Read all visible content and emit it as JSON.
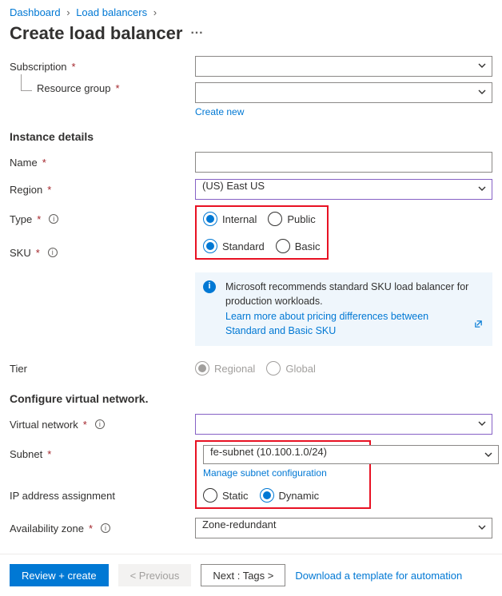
{
  "breadcrumb": {
    "items": [
      "Dashboard",
      "Load balancers"
    ]
  },
  "page_title": "Create load balancer",
  "subscription": {
    "label": "Subscription",
    "value": ""
  },
  "resource_group": {
    "label": "Resource group",
    "value": "",
    "create_new": "Create new"
  },
  "sections": {
    "instance": "Instance details",
    "configure_vnet": "Configure virtual network."
  },
  "name": {
    "label": "Name",
    "value": ""
  },
  "region": {
    "label": "Region",
    "value": "(US) East US"
  },
  "type": {
    "label": "Type",
    "options": {
      "internal": "Internal",
      "public": "Public"
    },
    "selected": "internal"
  },
  "sku": {
    "label": "SKU",
    "options": {
      "standard": "Standard",
      "basic": "Basic"
    },
    "selected": "standard"
  },
  "info_panel": {
    "text": "Microsoft recommends standard SKU load balancer for production workloads.",
    "link": "Learn more about pricing differences between Standard and Basic SKU"
  },
  "tier": {
    "label": "Tier",
    "options": {
      "regional": "Regional",
      "global": "Global"
    }
  },
  "vnet": {
    "label": "Virtual network",
    "value": ""
  },
  "subnet": {
    "label": "Subnet",
    "value": "fe-subnet (10.100.1.0/24)",
    "manage_link": "Manage subnet configuration"
  },
  "ip_assignment": {
    "label": "IP address assignment",
    "options": {
      "static": "Static",
      "dynamic": "Dynamic"
    },
    "selected": "dynamic"
  },
  "availability_zone": {
    "label": "Availability zone",
    "value": "Zone-redundant"
  },
  "footer": {
    "review": "Review + create",
    "previous": "< Previous",
    "next": "Next : Tags >",
    "download": "Download a template for automation"
  }
}
